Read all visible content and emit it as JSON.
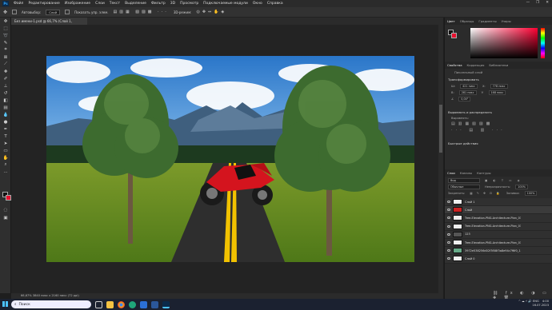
{
  "app": {
    "logo": "Ps"
  },
  "menu": [
    "Файл",
    "Редактирование",
    "Изображение",
    "Слои",
    "Текст",
    "Выделение",
    "Фильтр",
    "3D",
    "Просмотр",
    "Подключаемые модули",
    "Окно",
    "Справка"
  ],
  "options_bar": {
    "auto_select_label": "Автовыбор:",
    "auto_select_value": "Слой",
    "show_controls": "Показать упр. элем.",
    "mode_3d": "3D-режим:"
  },
  "document": {
    "tab_title": "Без имени-1.psd @ 66,7% (Слой 1, RGB/8#) *",
    "status": "66,67%   3840 пикс x 2160 пикс (72 ppi)"
  },
  "panels": {
    "top_tabs": [
      "Цвет",
      "Образцы",
      "Градиенты",
      "Узоры"
    ],
    "props_tabs": [
      "Свойства",
      "Коррекция",
      "Библиотеки"
    ],
    "props_title": "Пиксельный слой",
    "transform_title": "Трансформировать",
    "w_label": "Ш:",
    "w_value": "421 пикс",
    "h_label": "В:",
    "h_value": "281 пикс",
    "x_label": "X:",
    "x_value": "778 пикс",
    "y_label": "Y:",
    "y_value": "168 пикс",
    "angle": "0,00°",
    "align_title": "Выровнять и распределить",
    "align_sub": "Выровнять:",
    "quick_title": "Быстрые действия",
    "layers_tabs": [
      "Слои",
      "Каналы",
      "Контуры"
    ],
    "kind": "Вид",
    "blend": "Обычные",
    "opacity_label": "Непрозрачность:",
    "opacity_value": "100%",
    "lock_label": "Закрепить:",
    "fill_label": "Заливка:",
    "fill_value": "100%",
    "layers": [
      {
        "name": "Слой 1",
        "selected": false
      },
      {
        "name": "Слой",
        "selected": true
      },
      {
        "name": "Tree-Elevation-PNG-Architecture-Plan_01-228-000",
        "selected": false
      },
      {
        "name": "Tree-Elevation-PNG-Architecture-Plan_01-228-000",
        "selected": false
      },
      {
        "name": "123",
        "selected": false
      },
      {
        "name": "Tree-Elevation-PNG-Architecture-Plan_01-228-000",
        "selected": false
      },
      {
        "name": "3972e538256d02f3f08f3a8e94c7f6f0_1",
        "selected": false
      },
      {
        "name": "Слой 0",
        "selected": false
      }
    ]
  },
  "taskbar": {
    "search": "Поиск",
    "lang": "ENG",
    "time": "4:00",
    "date": "16.07.2023"
  },
  "colors": {
    "foreground": "#111111",
    "background": "#e8102e",
    "picker": "#ff0033"
  }
}
